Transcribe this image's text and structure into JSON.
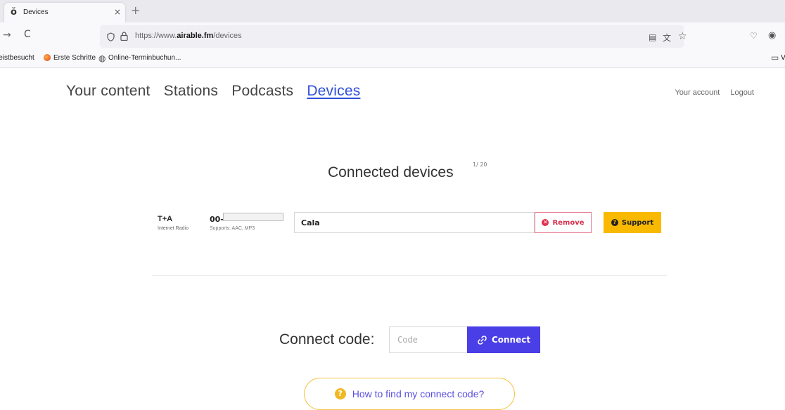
{
  "browser": {
    "tab": {
      "favicon": "ŏ",
      "title": "Devices",
      "close": "×"
    },
    "new_tab": "+",
    "nav": {
      "forward": "→",
      "reload": "C"
    },
    "url": {
      "prefix": "https://www.",
      "domain": "airable.fm",
      "path": "/devices"
    },
    "icons": [
      "shield-icon",
      "lock-icon",
      "reader-view-icon",
      "translate-icon",
      "star-icon",
      "pocket-icon",
      "account-icon"
    ],
    "bookmarks": [
      {
        "label": "leistbesucht"
      },
      {
        "label": "Erste Schritte"
      },
      {
        "label": "Online-Terminbuchun..."
      }
    ],
    "bookmarks_folder": "V"
  },
  "nav": {
    "links": [
      "Your content",
      "Stations",
      "Podcasts",
      "Devices"
    ],
    "active_index": 3,
    "active_color": "#2f4fd8"
  },
  "account": {
    "your_account": "Your account",
    "logout": "Logout"
  },
  "devices": {
    "heading": "Connected devices",
    "count": "1/ 20",
    "items": [
      {
        "brand": "T+A",
        "type": "Internet Radio",
        "id_prefix": "00-",
        "supports": "Supports: AAC, MP3",
        "name": "Cala",
        "remove_label": "Remove",
        "support_label": "Support"
      }
    ]
  },
  "connect": {
    "label": "Connect code:",
    "placeholder": "Code",
    "button_label": "Connect",
    "button_color": "#4a3ee6"
  },
  "help": {
    "label": "How to find my connect code?",
    "accent": "#f2b822"
  }
}
